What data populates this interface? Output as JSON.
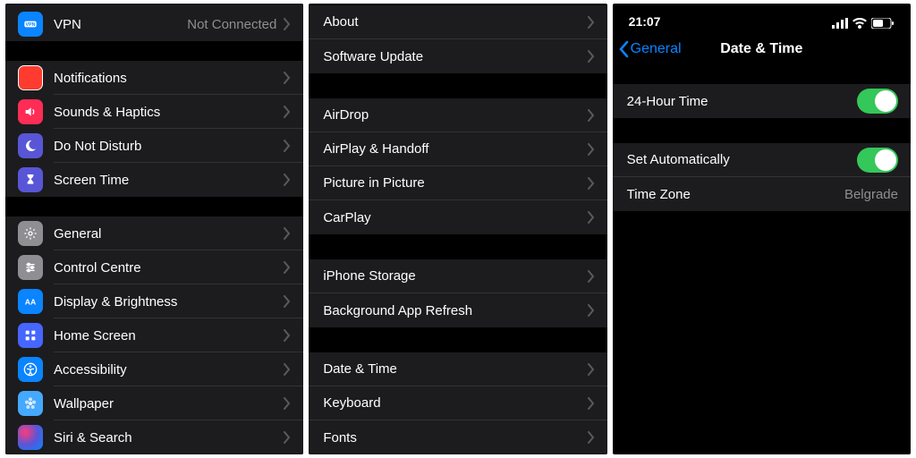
{
  "panel1": {
    "vpn": {
      "label": "VPN",
      "value": "Not Connected",
      "icon": "vpn",
      "bg": "#0a84ff"
    },
    "g2": [
      {
        "label": "Notifications",
        "icon": "bell",
        "bg": "#ff3b30"
      },
      {
        "label": "Sounds & Haptics",
        "icon": "speaker",
        "bg": "#ff2d55"
      },
      {
        "label": "Do Not Disturb",
        "icon": "moon",
        "bg": "#5856d6"
      },
      {
        "label": "Screen Time",
        "icon": "hourglass",
        "bg": "#5856d6"
      }
    ],
    "g3": [
      {
        "label": "General",
        "icon": "gear",
        "bg": "#8e8e93"
      },
      {
        "label": "Control Centre",
        "icon": "sliders",
        "bg": "#8e8e93"
      },
      {
        "label": "Display & Brightness",
        "icon": "aa",
        "bg": "#0a84ff"
      },
      {
        "label": "Home Screen",
        "icon": "grid",
        "bg": "#4566ff"
      },
      {
        "label": "Accessibility",
        "icon": "person",
        "bg": "#0a84ff"
      },
      {
        "label": "Wallpaper",
        "icon": "flower",
        "bg": "#45a9ff"
      },
      {
        "label": "Siri & Search",
        "icon": "siri",
        "bg": "#1c1c1e"
      }
    ]
  },
  "panel2": {
    "g1": [
      {
        "label": "About"
      },
      {
        "label": "Software Update"
      }
    ],
    "g2": [
      {
        "label": "AirDrop"
      },
      {
        "label": "AirPlay & Handoff"
      },
      {
        "label": "Picture in Picture"
      },
      {
        "label": "CarPlay"
      }
    ],
    "g3": [
      {
        "label": "iPhone Storage"
      },
      {
        "label": "Background App Refresh"
      }
    ],
    "g4": [
      {
        "label": "Date & Time"
      },
      {
        "label": "Keyboard"
      },
      {
        "label": "Fonts"
      }
    ]
  },
  "panel3": {
    "status_time": "21:07",
    "back": "General",
    "title": "Date & Time",
    "r1": {
      "label": "24-Hour Time"
    },
    "r2": {
      "label": "Set Automatically"
    },
    "r3": {
      "label": "Time Zone",
      "value": "Belgrade"
    }
  }
}
